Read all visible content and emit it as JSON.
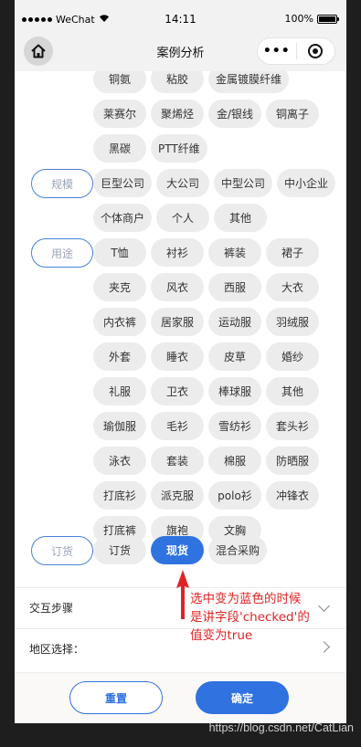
{
  "status_bar": {
    "carrier": "WeChat",
    "time": "14:11",
    "battery": "100%",
    "battery_level": 1.0
  },
  "nav": {
    "title": "案例分析"
  },
  "material": {
    "options": [
      "铜氨",
      "粘胶",
      "金属镀膜纤维",
      "莱赛尔",
      "聚烯烃",
      "金/银线",
      "铜离子",
      "黑碳",
      "PTT纤维"
    ]
  },
  "scale": {
    "label": "规模",
    "options": [
      "巨型公司",
      "大公司",
      "中型公司",
      "中小企业",
      "个体商户",
      "个人",
      "其他"
    ]
  },
  "use": {
    "label": "用途",
    "options": [
      "T恤",
      "衬衫",
      "裤装",
      "裙子",
      "夹克",
      "风衣",
      "西服",
      "大衣",
      "内衣裤",
      "居家服",
      "运动服",
      "羽绒服",
      "外套",
      "睡衣",
      "皮草",
      "婚纱",
      "礼服",
      "卫衣",
      "棒球服",
      "其他",
      "瑜伽服",
      "毛衫",
      "雪纺衫",
      "套头衫",
      "泳衣",
      "套装",
      "棉服",
      "防晒服",
      "打底衫",
      "派克服",
      "polo衫",
      "冲锋衣",
      "打底裤",
      "旗袍",
      "文胸"
    ]
  },
  "order": {
    "label": "订货",
    "options": [
      "订货",
      "现货",
      "混合采购"
    ],
    "selected": "现货"
  },
  "rows": {
    "steps": "交互步骤",
    "region": "地区选择："
  },
  "annotation": {
    "line1": "选中变为蓝色的时候",
    "line2": "是讲字段'checked'的",
    "line3": "值变为true"
  },
  "footer": {
    "reset": "重置",
    "confirm": "确定"
  },
  "watermark": "https://blog.csdn.net/CatLian",
  "colors": {
    "accent": "#2f72e0",
    "annotation": "#e02424",
    "chip_bg": "#ececec"
  }
}
